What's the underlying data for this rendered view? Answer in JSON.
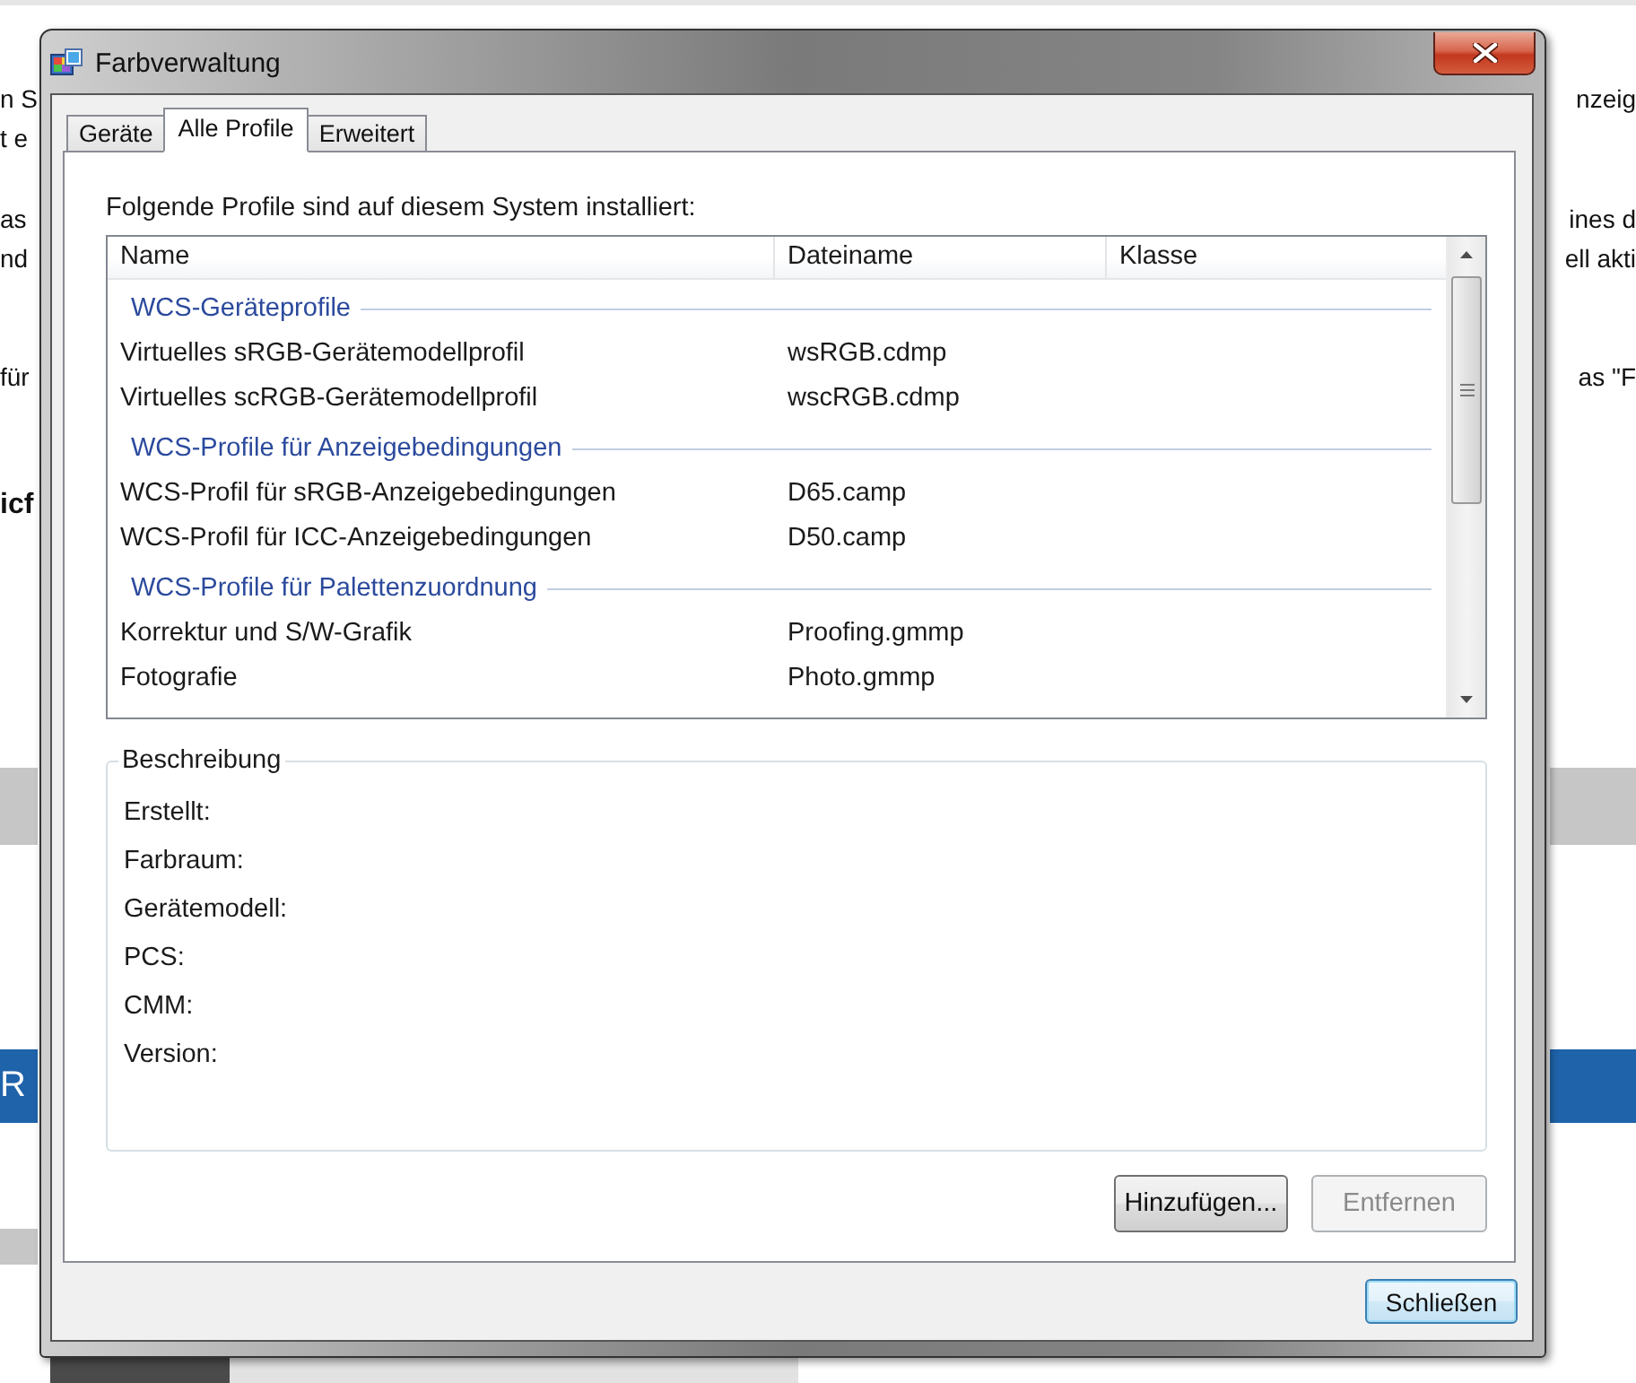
{
  "background": {
    "paragraphs": [
      {
        "kind": "text",
        "lines": [
          {
            "left": "n S",
            "right": "nzeig"
          },
          {
            "left": "t e"
          }
        ]
      },
      {
        "kind": "text",
        "lines": [
          {
            "left": "as",
            "right": "ines d"
          },
          {
            "left": "nd",
            "right": "ell akti"
          }
        ]
      },
      {
        "kind": "text",
        "lines": [
          {
            "left": "für",
            "right": "as \"F"
          }
        ]
      },
      {
        "kind": "heading",
        "lines": [
          {
            "left": "icf"
          }
        ]
      }
    ],
    "banner": {
      "text": "R"
    }
  },
  "window": {
    "title": "Farbverwaltung"
  },
  "tabs": [
    {
      "label": "Geräte",
      "selected": false
    },
    {
      "label": "Alle Profile",
      "selected": true
    },
    {
      "label": "Erweitert",
      "selected": false
    }
  ],
  "profiles": {
    "intro": "Folgende Profile sind auf diesem System installiert:",
    "columns": [
      "Name",
      "Dateiname",
      "Klasse"
    ],
    "groups": [
      {
        "title": "WCS-Geräteprofile",
        "rows": [
          {
            "name": "Virtuelles sRGB-Gerätemodellprofil",
            "file": "wsRGB.cdmp"
          },
          {
            "name": "Virtuelles scRGB-Gerätemodellprofil",
            "file": "wscRGB.cdmp"
          }
        ]
      },
      {
        "title": "WCS-Profile für Anzeigebedingungen",
        "rows": [
          {
            "name": "WCS-Profil für sRGB-Anzeigebedingungen",
            "file": "D65.camp"
          },
          {
            "name": "WCS-Profil für ICC-Anzeigebedingungen",
            "file": "D50.camp"
          }
        ]
      },
      {
        "title": "WCS-Profile für Palettenzuordnung",
        "rows": [
          {
            "name": "Korrektur und S/W-Grafik",
            "file": "Proofing.gmmp"
          },
          {
            "name": "Fotografie",
            "file": "Photo.gmmp"
          }
        ]
      }
    ]
  },
  "description": {
    "title": "Beschreibung",
    "fields": [
      "Erstellt:",
      "Farbraum:",
      "Gerätemodell:",
      "PCS:",
      "CMM:",
      "Version:"
    ]
  },
  "actions": [
    {
      "label": "Hinzufügen...",
      "disabled": false
    },
    {
      "label": "Entfernen",
      "disabled": true
    }
  ],
  "footer_button": {
    "label": "Schließen",
    "default": true
  }
}
